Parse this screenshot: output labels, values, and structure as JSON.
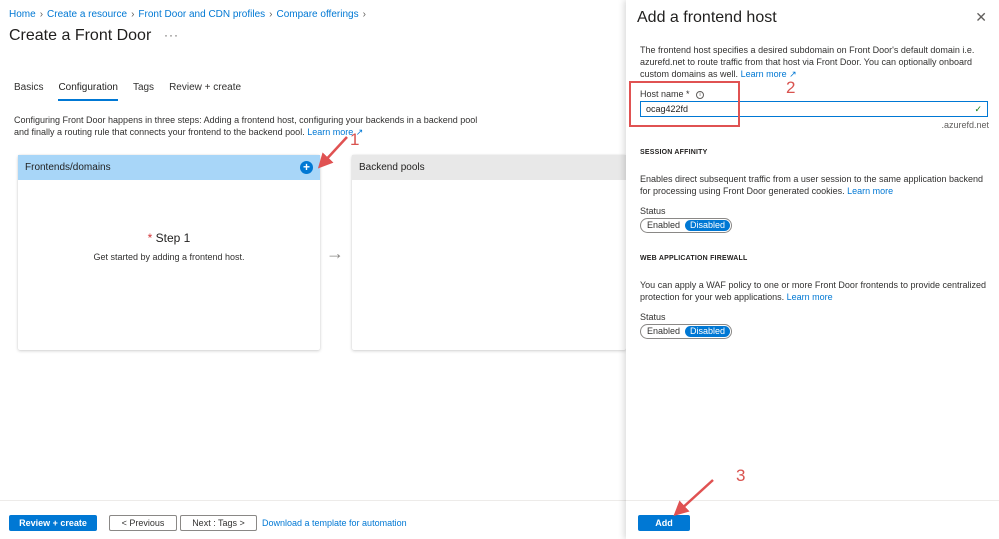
{
  "breadcrumb": [
    "Home",
    "Create a resource",
    "Front Door and CDN profiles",
    "Compare offerings"
  ],
  "page": {
    "title": "Create a Front Door",
    "more": "···"
  },
  "tabs": [
    "Basics",
    "Configuration",
    "Tags",
    "Review + create"
  ],
  "intro": {
    "text": "Configuring Front Door happens in three steps: Adding a frontend host, configuring your backends in a backend pool and finally a routing rule that connects your frontend to the backend pool.",
    "link": "Learn more"
  },
  "cards": {
    "frontends": "Frontends/domains",
    "backends": "Backend pools",
    "step_star": "*",
    "step_title": "Step 1",
    "step_desc": "Get started by adding a frontend host."
  },
  "footer": {
    "review": "Review + create",
    "previous": "< Previous",
    "next": "Next : Tags >",
    "download": "Download a template for automation"
  },
  "panel": {
    "title": "Add a frontend host",
    "close": "✕",
    "desc": "The frontend host specifies a desired subdomain on Front Door's default domain i.e. azurefd.net to route traffic from that host via Front Door. You can optionally onboard custom domains as well.",
    "desc_link": "Learn more",
    "host_label": "Host name *",
    "host_value": "ocag422fd",
    "host_suffix": ".azurefd.net",
    "session_title": "SESSION AFFINITY",
    "session_desc": "Enables direct subsequent traffic from a user session to the same application backend for processing using Front Door generated cookies.",
    "session_link": "Learn more",
    "status_label": "Status",
    "enabled": "Enabled",
    "disabled": "Disabled",
    "waf_title": "WEB APPLICATION FIREWALL",
    "waf_desc": "You can apply a WAF policy to one or more Front Door frontends to provide centralized protection for your web applications.",
    "waf_link": "Learn more",
    "add": "Add"
  },
  "annotations": [
    "1",
    "2",
    "3"
  ],
  "colors": {
    "accent": "#0078d4",
    "annotation": "#e05252",
    "card_head_active": "#a8d6f8"
  }
}
